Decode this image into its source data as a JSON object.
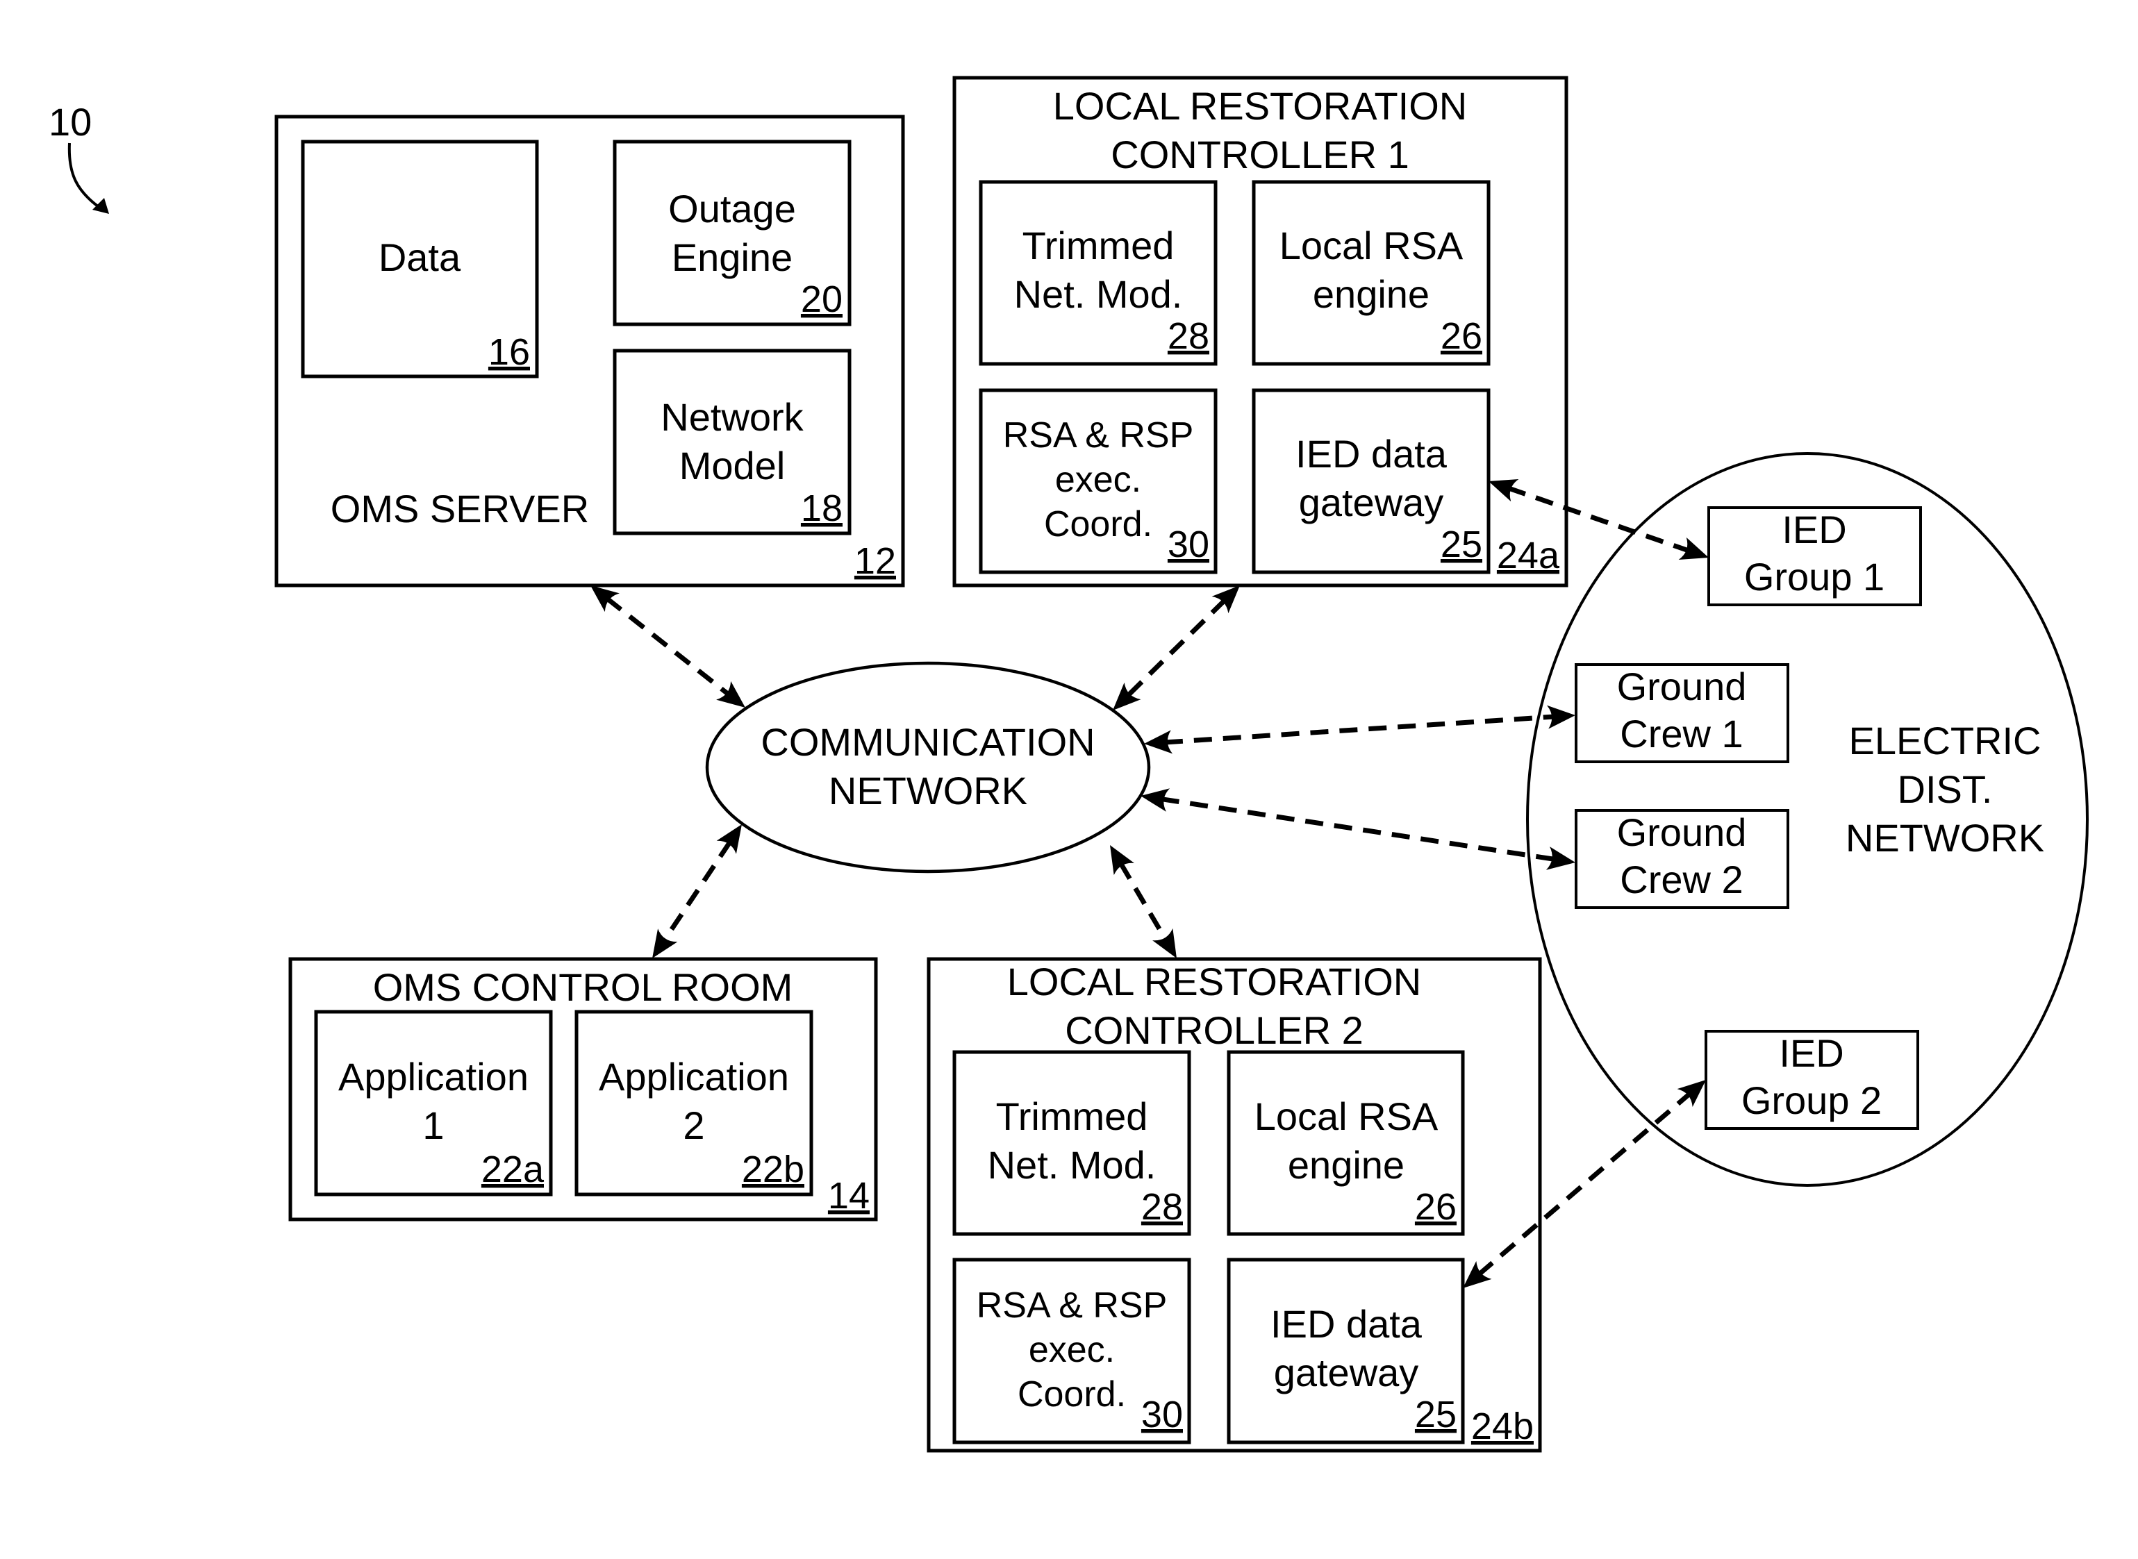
{
  "figure": {
    "ref": "10"
  },
  "oms_server": {
    "title": "OMS SERVER",
    "ref": "12",
    "data": {
      "line1": "Data",
      "ref": "16"
    },
    "outage_engine": {
      "line1": "Outage",
      "line2": "Engine",
      "ref": "20"
    },
    "network_model": {
      "line1": "Network",
      "line2": "Model",
      "ref": "18"
    }
  },
  "lrc1": {
    "title_line1": "LOCAL RESTORATION",
    "title_line2": "CONTROLLER 1",
    "ref": "24a",
    "trimmed": {
      "line1": "Trimmed",
      "line2": "Net. Mod.",
      "ref": "28"
    },
    "local_rsa": {
      "line1": "Local RSA",
      "line2": "engine",
      "ref": "26"
    },
    "rsa_rsp": {
      "line1": "RSA & RSP",
      "line2": "exec.",
      "line3": "Coord.",
      "ref": "30"
    },
    "ied_gateway": {
      "line1": "IED data",
      "line2": "gateway",
      "ref": "25"
    }
  },
  "lrc2": {
    "title_line1": "LOCAL RESTORATION",
    "title_line2": "CONTROLLER 2",
    "ref": "24b",
    "trimmed": {
      "line1": "Trimmed",
      "line2": "Net. Mod.",
      "ref": "28"
    },
    "local_rsa": {
      "line1": "Local RSA",
      "line2": "engine",
      "ref": "26"
    },
    "rsa_rsp": {
      "line1": "RSA & RSP",
      "line2": "exec.",
      "line3": "Coord.",
      "ref": "30"
    },
    "ied_gateway": {
      "line1": "IED data",
      "line2": "gateway",
      "ref": "25"
    }
  },
  "communication_network": {
    "line1": "COMMUNICATION",
    "line2": "NETWORK"
  },
  "oms_control_room": {
    "title": "OMS CONTROL ROOM",
    "ref": "14",
    "app1": {
      "line1": "Application",
      "line2": "1",
      "ref": "22a"
    },
    "app2": {
      "line1": "Application",
      "line2": "2",
      "ref": "22b"
    }
  },
  "electric_network": {
    "line1": "ELECTRIC",
    "line2": "DIST.",
    "line3": "NETWORK",
    "ied_group1": {
      "line1": "IED",
      "line2": "Group 1"
    },
    "ground_crew1": {
      "line1": "Ground",
      "line2": "Crew 1"
    },
    "ground_crew2": {
      "line1": "Ground",
      "line2": "Crew 2"
    },
    "ied_group2": {
      "line1": "IED",
      "line2": "Group 2"
    }
  },
  "connections": [
    {
      "from": "oms_server",
      "to": "communication_network",
      "style": "dashed",
      "direction": "bidirectional"
    },
    {
      "from": "lrc1",
      "to": "communication_network",
      "style": "dashed",
      "direction": "bidirectional"
    },
    {
      "from": "communication_network",
      "to": "ground_crew1",
      "style": "dashed",
      "direction": "bidirectional"
    },
    {
      "from": "communication_network",
      "to": "ground_crew2",
      "style": "dashed",
      "direction": "bidirectional"
    },
    {
      "from": "communication_network",
      "to": "oms_control_room",
      "style": "dashed",
      "direction": "bidirectional"
    },
    {
      "from": "communication_network",
      "to": "lrc2",
      "style": "dashed",
      "direction": "bidirectional"
    },
    {
      "from": "lrc1.ied_gateway",
      "to": "ied_group1",
      "style": "dashed",
      "direction": "bidirectional"
    },
    {
      "from": "lrc2.ied_gateway",
      "to": "ied_group2",
      "style": "dashed",
      "direction": "bidirectional"
    }
  ]
}
